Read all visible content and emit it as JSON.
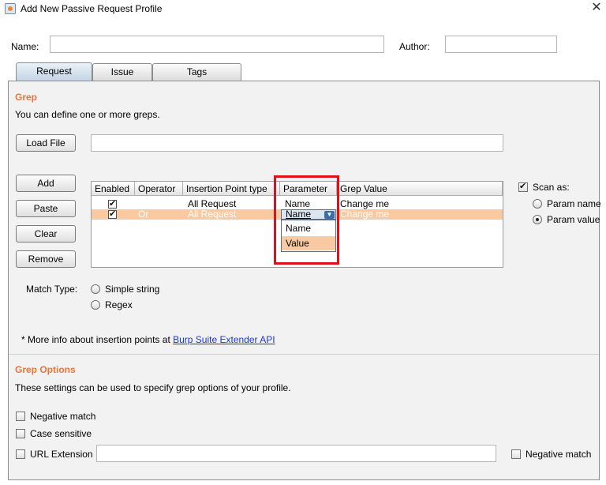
{
  "window": {
    "title": "Add New Passive Request Profile",
    "close_glyph": "✕"
  },
  "profile": {
    "name_label": "Name:",
    "name_value": "",
    "author_label": "Author:",
    "author_value": ""
  },
  "tabs": [
    {
      "label": "Request",
      "active": true
    },
    {
      "label": "Issue",
      "active": false
    },
    {
      "label": "Tags",
      "active": false
    }
  ],
  "grep": {
    "section_title": "Grep",
    "description": "You can define one or more greps.",
    "load_file_label": "Load File",
    "load_file_path": "",
    "buttons": {
      "add": "Add",
      "paste": "Paste",
      "clear": "Clear",
      "remove": "Remove"
    },
    "table": {
      "columns": [
        "Enabled",
        "Operator",
        "Insertion Point type",
        "Parameter",
        "Grep Value"
      ],
      "rows": [
        {
          "enabled": true,
          "operator": "",
          "insertion_point": "All Request",
          "parameter": "Name",
          "grep_value": "Change me",
          "selected": false
        },
        {
          "enabled": true,
          "operator": "Or",
          "insertion_point": "All Request",
          "parameter": "Name",
          "grep_value": "Change me",
          "selected": true
        }
      ],
      "parameter_dropdown": {
        "options": [
          "Name",
          "Value"
        ],
        "highlighted": "Value"
      }
    },
    "scan_as": {
      "label": "Scan as:",
      "checked": true,
      "options": [
        {
          "label": "Param name",
          "selected": false
        },
        {
          "label": "Param value",
          "selected": true
        }
      ]
    },
    "match_type": {
      "label": "Match Type:",
      "options": [
        {
          "label": "Simple string",
          "selected": false
        },
        {
          "label": "Regex",
          "selected": false
        }
      ]
    },
    "info_text": "* More info about insertion points at ",
    "info_link": "Burp Suite Extender API"
  },
  "grep_options": {
    "section_title": "Grep Options",
    "description": "These settings can be used to specify grep options of your profile.",
    "negative_match": "Negative match",
    "case_sensitive": "Case sensitive",
    "url_extension": "URL Extension",
    "url_extension_value": "",
    "url_negative_match": "Negative match"
  },
  "colors": {
    "accent": "#e8763a",
    "selected_row": "#f9c9a2",
    "highlight_box": "#e0101a",
    "link": "#1a35d6"
  }
}
